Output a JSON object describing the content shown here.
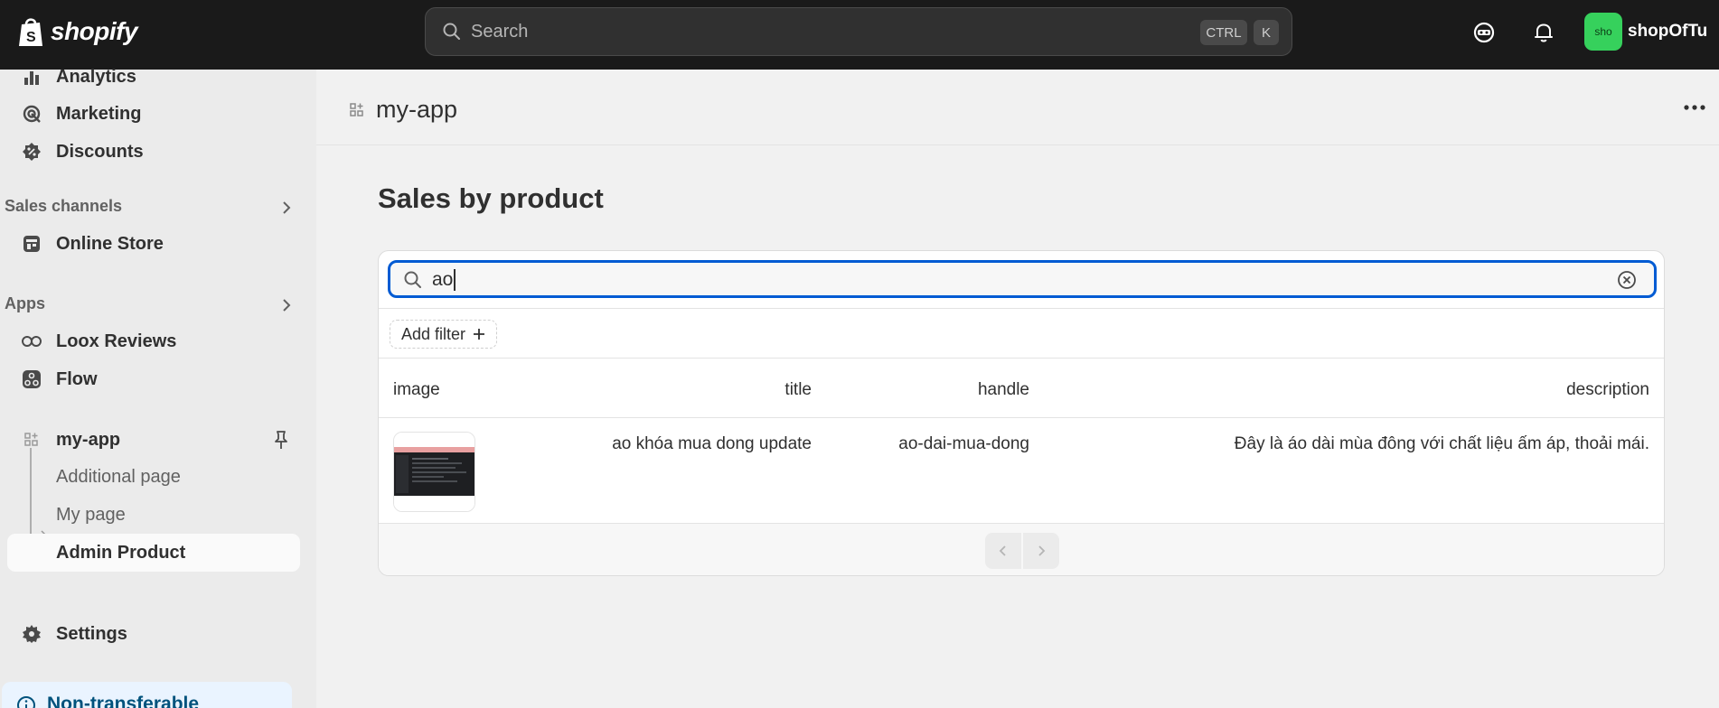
{
  "topbar": {
    "brand": "shopify",
    "search_placeholder": "Search",
    "shortcut_ctrl": "CTRL",
    "shortcut_k": "K",
    "avatar_initials": "sho",
    "store_name": "shopOfTu",
    "avatar_color": "#36d15c"
  },
  "sidebar": {
    "analytics": "Analytics",
    "marketing": "Marketing",
    "discounts": "Discounts",
    "sales_channels_heading": "Sales channels",
    "online_store": "Online Store",
    "apps_heading": "Apps",
    "loox_reviews": "Loox Reviews",
    "flow": "Flow",
    "my_app": "my-app",
    "sub_items": [
      "Additional page",
      "My page",
      "Admin Product"
    ],
    "settings": "Settings",
    "notice": "Non-transferable"
  },
  "main": {
    "app_title": "my-app",
    "section_title": "Sales by product",
    "filter_value": "ao",
    "add_filter_label": "Add filter",
    "columns": [
      "image",
      "title",
      "handle",
      "description"
    ],
    "rows": [
      {
        "title": "ao khóa mua dong update",
        "handle": "ao-dai-mua-dong",
        "description": "Đây là áo dài mùa đông với chất liệu ấm áp, thoải mái."
      }
    ]
  },
  "colors": {
    "accent": "#005bd3",
    "topbar": "#1a1a1a",
    "page_bg": "#f1f1f1"
  }
}
